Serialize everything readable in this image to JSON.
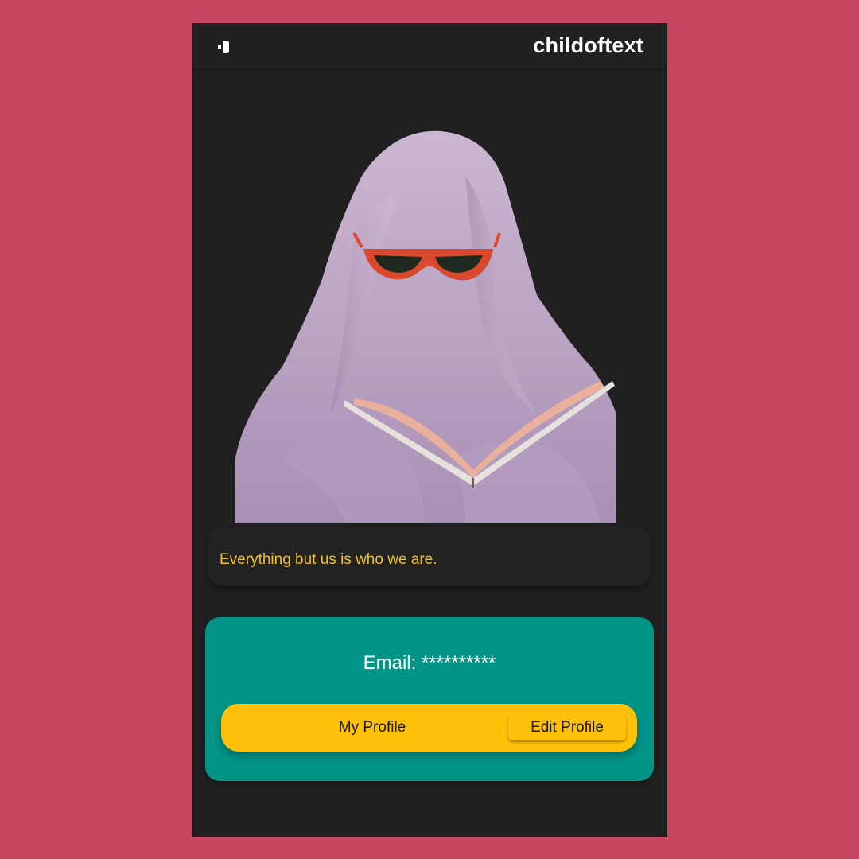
{
  "appbar": {
    "back_icon": "volume-speaker-icon",
    "title": "childoftext"
  },
  "photo": {
    "description_icon": "ghost-photo-image"
  },
  "quote": {
    "text": "Everything but us is who we are."
  },
  "account": {
    "email_label": "Email:",
    "email_value": "**********"
  },
  "buttons": {
    "my_profile": "My Profile",
    "edit_profile": "Edit Profile"
  },
  "colors": {
    "page_background": "#c74662",
    "app_background": "#202020",
    "accent_teal": "#029587",
    "accent_yellow": "#fec008",
    "quote_text": "#f3c21d"
  }
}
